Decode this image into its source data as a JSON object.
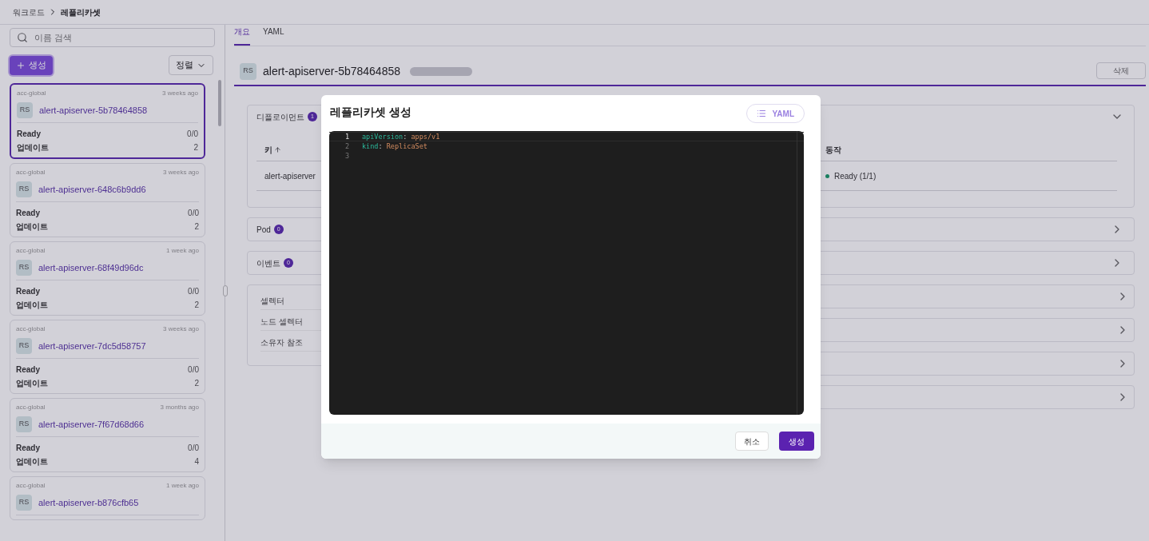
{
  "breadcrumb": [
    "워크로드",
    "레플리카셋"
  ],
  "sidebar": {
    "search": {
      "placeholder": "이름 검색"
    },
    "create_button": "생성",
    "sort_button": "정렬",
    "cards": [
      {
        "namespace": "acc-global",
        "age": "3 weeks ago",
        "badge": "RS",
        "name": "alert-apiserver-5b78464858",
        "ready_label": "Ready",
        "ready": "0/0",
        "update_label": "업데이트",
        "updates": "2",
        "selected": true
      },
      {
        "namespace": "acc-global",
        "age": "3 weeks ago",
        "badge": "RS",
        "name": "alert-apiserver-648c6b9dd6",
        "ready_label": "Ready",
        "ready": "0/0",
        "update_label": "업데이트",
        "updates": "2",
        "selected": false
      },
      {
        "namespace": "acc-global",
        "age": "1 week ago",
        "badge": "RS",
        "name": "alert-apiserver-68f49d96dc",
        "ready_label": "Ready",
        "ready": "0/0",
        "update_label": "업데이트",
        "updates": "2",
        "selected": false
      },
      {
        "namespace": "acc-global",
        "age": "3 weeks ago",
        "badge": "RS",
        "name": "alert-apiserver-7dc5d58757",
        "ready_label": "Ready",
        "ready": "0/0",
        "update_label": "업데이트",
        "updates": "2",
        "selected": false
      },
      {
        "namespace": "acc-global",
        "age": "3 months ago",
        "badge": "RS",
        "name": "alert-apiserver-7f67d68d66",
        "ready_label": "Ready",
        "ready": "0/0",
        "update_label": "업데이트",
        "updates": "4",
        "selected": false
      },
      {
        "namespace": "acc-global",
        "age": "1 week ago",
        "badge": "RS",
        "name": "alert-apiserver-b876cfb65",
        "selected": false
      }
    ]
  },
  "tabs": [
    {
      "label": "개요",
      "selected": true
    },
    {
      "label": "YAML",
      "selected": false
    }
  ],
  "header": {
    "badge": "RS",
    "title": "alert-apiserver-5b78464858",
    "delete_button": "삭제"
  },
  "sections": [
    {
      "title": "디플로이먼트",
      "count": "1",
      "expanded": true,
      "columns": [
        "키",
        "동작"
      ],
      "rows": [
        {
          "key": "alert-apiserver",
          "status": "Ready (1/1)"
        }
      ]
    },
    {
      "title": "Pod",
      "count": "0",
      "expanded": false
    },
    {
      "title": "이벤트",
      "count": "0",
      "expanded": false
    }
  ],
  "metadata": {
    "labels": [
      "셀렉터",
      "노드 셀렉터",
      "소유자 참조"
    ],
    "rows": [
      {
        "expanded": false
      },
      {
        "expanded": false
      },
      {
        "expanded": false
      },
      {
        "expanded": false
      }
    ]
  },
  "dialog": {
    "title": "레플리카셋 생성",
    "yaml_button": "YAML",
    "lines": [
      {
        "number": "1",
        "active": true,
        "tokens": [
          {
            "kind": "key",
            "text": "apiVersion"
          },
          {
            "kind": "punct",
            "text": ": "
          },
          {
            "kind": "value",
            "text": "apps/v1"
          }
        ]
      },
      {
        "number": "2",
        "active": false,
        "tokens": [
          {
            "kind": "key",
            "text": "kind"
          },
          {
            "kind": "punct",
            "text": ": "
          },
          {
            "kind": "value",
            "text": "ReplicaSet"
          }
        ]
      },
      {
        "number": "3",
        "active": false
      }
    ],
    "cancel_button": "취소",
    "submit_button": "생성"
  }
}
